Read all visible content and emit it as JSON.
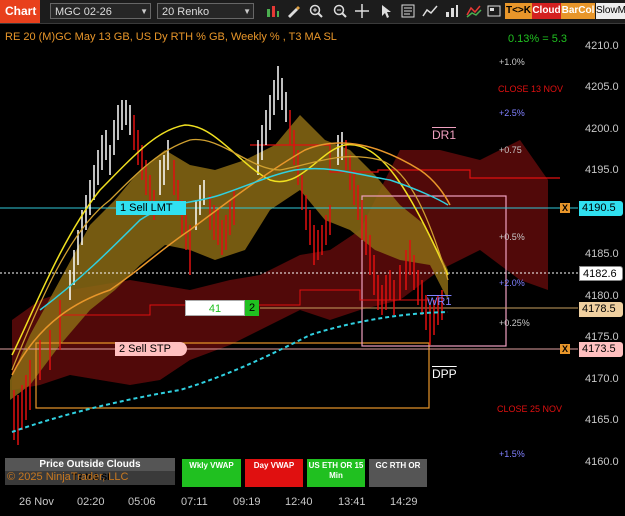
{
  "toolbar": {
    "chart_tab": "Chart",
    "instrument": "MGC 02-26",
    "bar_type": "20 Renko",
    "btn_tk": "T<>K",
    "btn_cloud": "Cloud",
    "btn_barcol": "BarCol",
    "btn_slowm": "SlowM",
    "colors": {
      "tk": "#e8962a",
      "cloud": "#d42020",
      "barcol": "#e8962a"
    }
  },
  "header": {
    "title": "RE 20  (M)GC May 13 GB, US Dy RTH % GB, Weekly % , T3 MA SL",
    "pct_change": "0.13% = 5.3"
  },
  "right_labels": {
    "p1_0": "+1.0%",
    "close_13nov": "CLOSE 13 NOV",
    "p2_5": "+2.5%",
    "dr1": "DR1",
    "p0_75": "+0.75",
    "p0_5": "+0.5%",
    "p2_0": "+2.0%",
    "wr1": "WR1",
    "p0_25": "+0.25%",
    "dpp": "DPP",
    "close_25nov": "CLOSE 25 NOV",
    "p1_5": "+1.5%"
  },
  "orders": {
    "sell_lmt": "1 Sell LMT",
    "sell_stp": "2 Sell STP",
    "pos_left": "41",
    "pos_right": "2",
    "x_mark": "X"
  },
  "price_axis": [
    "4210.0",
    "4205.0",
    "4200.0",
    "4195.0",
    "4190.0",
    "4185.0",
    "4180.0",
    "4175.0",
    "4170.0",
    "4165.0",
    "4160.0"
  ],
  "price_markers": {
    "sell_lmt": "4190.5",
    "last": "4182.6",
    "mid": "4178.5",
    "sell_stp": "4173.5"
  },
  "time_axis": [
    "26 Nov",
    "02:20",
    "05:06",
    "07:11",
    "09:19",
    "12:40",
    "13:41",
    "14:29"
  ],
  "bottom_panel": {
    "price_outside": "Price Outside Clouds",
    "t3_ma": "T3 MA SL",
    "copyright": "© 2025 NinjaTrader, LLC",
    "wkly_vwap": "Wkly VWAP",
    "day_vwap": "Day VWAP",
    "us_eth": "US ETH OR 15 Min",
    "gc_rth": "GC RTH OR"
  },
  "colors": {
    "background": "#000000",
    "up_bar": "#ffffff",
    "down_bar": "#e01010",
    "cloud_gold": "#8a6a14",
    "cloud_red": "#5a0a0a",
    "cyan": "#30d0e0",
    "sell_lmt_bg": "#30e0f0",
    "sell_stp_bg": "#ffc0c0",
    "green": "#20c020",
    "orange": "#e8962a",
    "yellow": "#f0e020"
  }
}
